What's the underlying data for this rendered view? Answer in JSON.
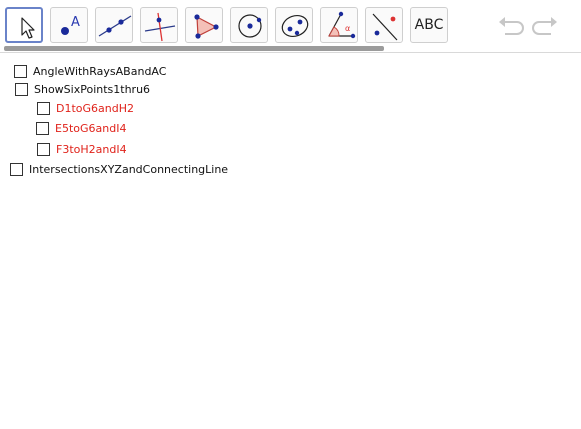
{
  "toolbar": {
    "tools": [
      {
        "name": "move-tool",
        "icon": "arrow-cursor-icon"
      },
      {
        "name": "point-tool",
        "icon": "point-icon",
        "label_glyph": "A"
      },
      {
        "name": "line-tool",
        "icon": "line-through-two-points-icon"
      },
      {
        "name": "perpendicular-line-tool",
        "icon": "perpendicular-line-icon"
      },
      {
        "name": "polygon-tool",
        "icon": "polygon-icon"
      },
      {
        "name": "circle-tool",
        "icon": "circle-center-point-icon"
      },
      {
        "name": "conic-tool",
        "icon": "ellipse-icon"
      },
      {
        "name": "angle-tool",
        "icon": "angle-icon",
        "label_glyph": "α"
      },
      {
        "name": "reflect-tool",
        "icon": "reflect-about-line-icon"
      },
      {
        "name": "text-tool",
        "icon": "text-icon",
        "label": "ABC"
      }
    ],
    "undo_icon": "undo-icon",
    "redo_icon": "redo-icon",
    "accent_color": "#6a83c9",
    "point_color": "#1a2a9a",
    "line_color": "#2a3a8a"
  },
  "objects": [
    {
      "label": "AngleWithRaysABandAC",
      "checked": false,
      "color": "#111111"
    },
    {
      "label": "ShowSixPoints1thru6",
      "checked": false,
      "color": "#111111"
    },
    {
      "label": "D1toG6andH2",
      "checked": false,
      "color": "#e0231b"
    },
    {
      "label": "E5toG6andI4",
      "checked": false,
      "color": "#e0231b"
    },
    {
      "label": "F3toH2andI4",
      "checked": false,
      "color": "#e0231b"
    },
    {
      "label": "IntersectionsXYZandConnectingLine",
      "checked": false,
      "color": "#111111"
    }
  ]
}
